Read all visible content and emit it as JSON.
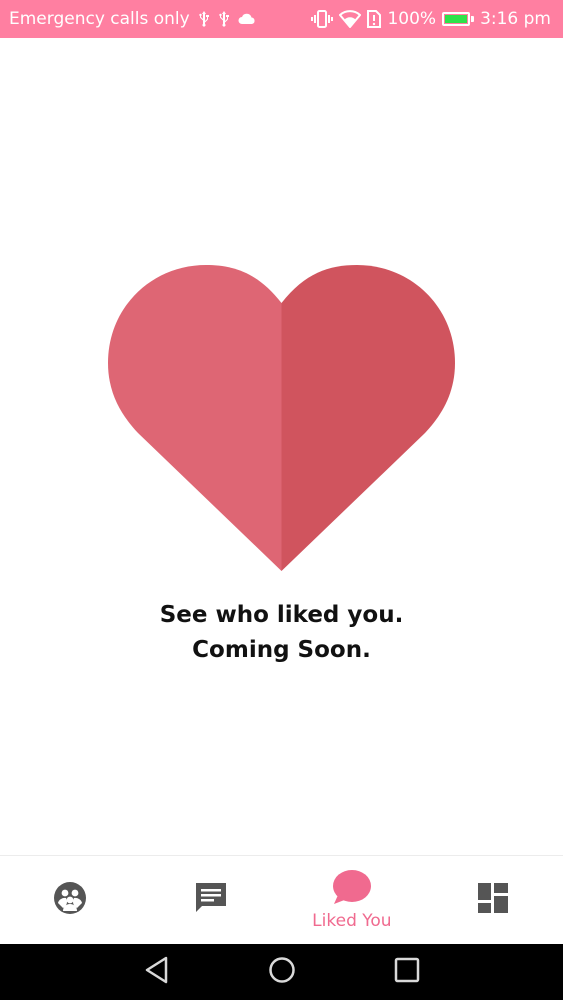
{
  "status_bar": {
    "carrier_text": "Emergency calls only",
    "battery_percent": "100%",
    "time": "3:16 pm",
    "background_color": "#ff7fa1",
    "battery_level": 1.0
  },
  "main": {
    "heart_colors": {
      "left": "#de6674",
      "right": "#d0545e"
    },
    "message_line1": "See who liked you.",
    "message_line2": "Coming Soon."
  },
  "bottom_nav": {
    "tabs": [
      {
        "id": "discover",
        "icon": "people-group-icon",
        "label": "",
        "active": false
      },
      {
        "id": "messages",
        "icon": "chat-message-icon",
        "label": "",
        "active": false
      },
      {
        "id": "liked_you",
        "icon": "speech-bubble-icon",
        "label": "Liked You",
        "active": true
      },
      {
        "id": "dashboard",
        "icon": "dashboard-icon",
        "label": "",
        "active": false
      }
    ],
    "active_color": "#f06a8f",
    "inactive_color": "#555555"
  },
  "system_nav": {
    "buttons": [
      "back-icon",
      "home-icon",
      "recents-icon"
    ]
  }
}
